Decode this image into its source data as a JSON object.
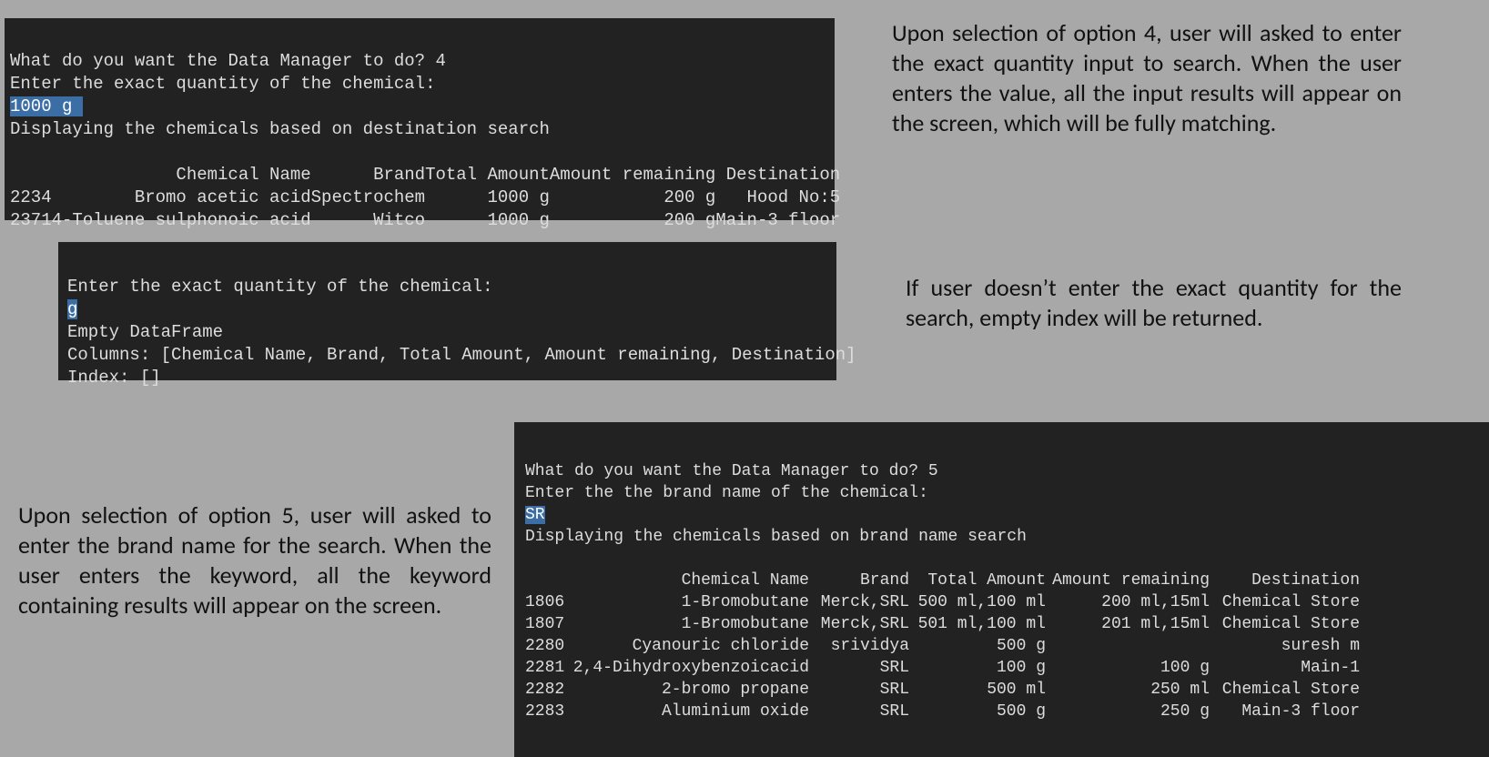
{
  "term1": {
    "line_prompt": "What do you want the Data Manager to do? 4",
    "line_enter": "Enter the exact quantity of the chemical:",
    "input_highlight": "1000 g ",
    "line_disp": "Displaying the chemicals based on destination search",
    "headers": {
      "idx": "",
      "cname": "Chemical Name",
      "brand": "Brand",
      "total": "Total Amount",
      "remain": "Amount remaining",
      "dest": "Destination"
    },
    "rows": [
      {
        "idx": "2234",
        "cname": "Bromo acetic acid",
        "brand": "Spectrochem",
        "total": "1000 g",
        "remain": "200 g",
        "dest": "Hood No:5"
      },
      {
        "idx": "2371",
        "cname": "4-Toluene sulphonoic acid",
        "brand": "Witco",
        "total": "1000 g",
        "remain": "200 g",
        "dest": "Main-3 floor"
      }
    ]
  },
  "term2": {
    "line_enter": "Enter the exact quantity of the chemical:",
    "input_highlight": "g",
    "line_empty": "Empty DataFrame",
    "line_cols": "Columns: [Chemical Name, Brand, Total Amount, Amount remaining, Destination]",
    "line_idx": "Index: []"
  },
  "term3": {
    "line_prompt": "What do you want the Data Manager to do? 5",
    "line_enter": "Enter the the brand name of the chemical:",
    "input_highlight": "SR",
    "line_disp": "Displaying the chemicals based on brand name search",
    "headers": {
      "idx": "",
      "cname": "Chemical Name",
      "brand": "Brand",
      "total": "Total Amount",
      "remain": "Amount remaining",
      "dest": "Destination"
    },
    "rows": [
      {
        "idx": "1806",
        "cname": "1-Bromobutane",
        "brand": "Merck,SRL",
        "total": "500 ml,100 ml",
        "remain": "200 ml,15ml",
        "dest": "Chemical Store"
      },
      {
        "idx": "1807",
        "cname": "1-Bromobutane",
        "brand": "Merck,SRL",
        "total": "501 ml,100 ml",
        "remain": "201 ml,15ml",
        "dest": "Chemical Store"
      },
      {
        "idx": "2280",
        "cname": "Cyanouric chloride",
        "brand": "srividya",
        "total": "500 g",
        "remain": "",
        "dest": "suresh m"
      },
      {
        "idx": "2281",
        "cname": "2,4-Dihydroxybenzoicacid",
        "brand": "SRL",
        "total": "100 g",
        "remain": "100 g",
        "dest": "Main-1"
      },
      {
        "idx": "2282",
        "cname": "2-bromo propane",
        "brand": "SRL",
        "total": "500 ml",
        "remain": "250 ml",
        "dest": "Chemical Store"
      },
      {
        "idx": "2283",
        "cname": "Aluminium oxide",
        "brand": "SRL",
        "total": "500 g",
        "remain": "250 g",
        "dest": "Main-3 floor"
      }
    ]
  },
  "captions": {
    "c1": "Upon selection of option 4, user will asked to enter the exact quantity input to search. When the user enters the value, all the input results will appear on the screen, which will be fully matching.",
    "c2": "If user doesn’t enter the exact quantity for the search, empty index will be returned.",
    "c3": "Upon selection of option 5, user will asked to enter the brand name for the search. When the user enters the keyword, all the keyword containing results will appear on the screen."
  }
}
